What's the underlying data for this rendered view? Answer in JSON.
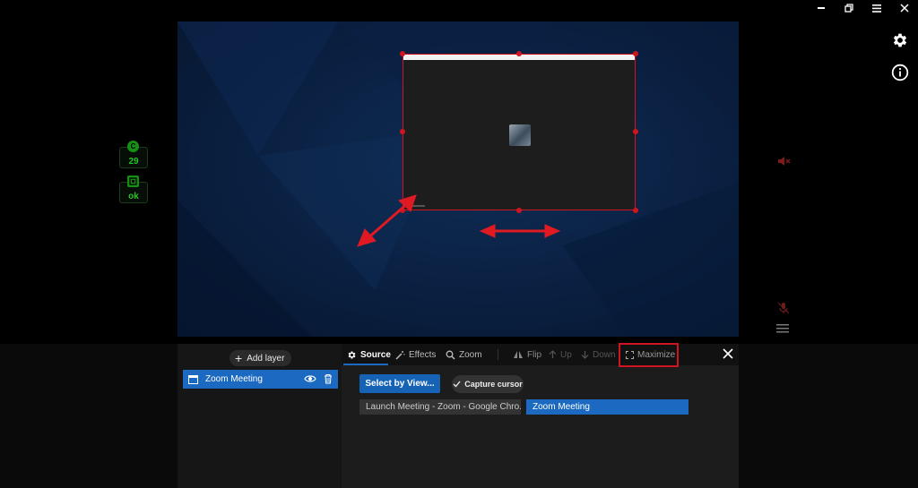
{
  "window": {
    "controls": [
      "minimize",
      "restore",
      "menu",
      "close"
    ]
  },
  "stats": {
    "fps_badge": "C",
    "fps_value": "29",
    "status_badge": "",
    "status_value": "ok",
    "color": "#23c423"
  },
  "layers": {
    "add_label": "Add layer",
    "items": [
      {
        "label": "Zoom Meeting"
      }
    ]
  },
  "tabs": {
    "source": "Source",
    "effects": "Effects",
    "zoom": "Zoom",
    "flip": "Flip",
    "up": "Up",
    "down": "Down",
    "maximize": "Maximize"
  },
  "source": {
    "select_button": "Select by View...",
    "capture_cursor": "Capture cursor",
    "windows": [
      {
        "label": "Launch Meeting - Zoom - Google Chro..."
      },
      {
        "label": "Zoom Meeting"
      }
    ]
  },
  "colors": {
    "accent": "#1b69c0",
    "highlight": "#d01520",
    "status_green": "#23c423"
  },
  "icons": {
    "settings": "gear-icon",
    "info": "info-icon",
    "mute": "speaker-muted-icon",
    "mic": "mic-muted-icon",
    "menu": "hamburger-icon"
  }
}
